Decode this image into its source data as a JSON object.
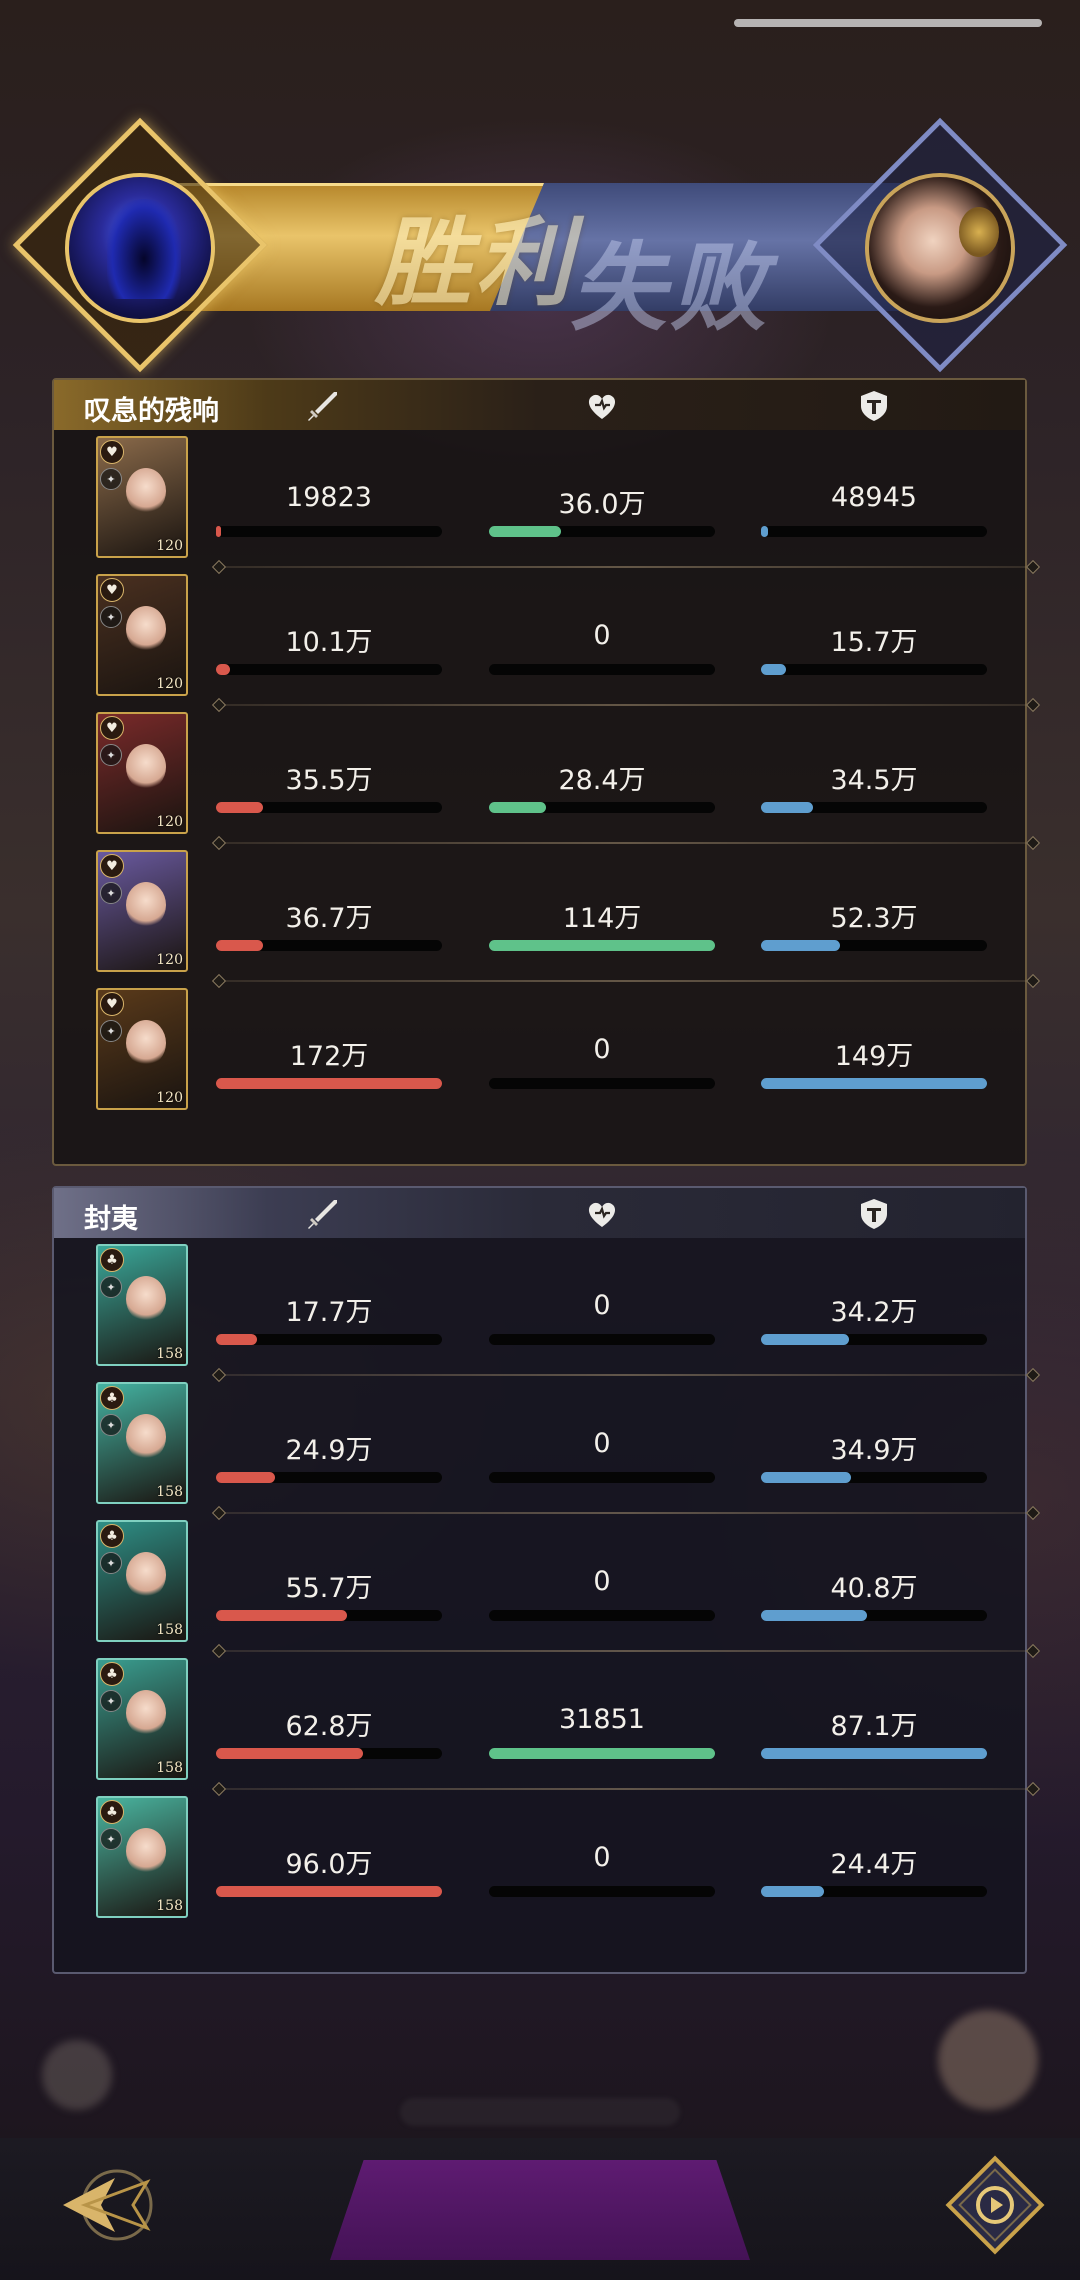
{
  "banner": {
    "win_label": "胜利",
    "lose_label": "失败"
  },
  "colors": {
    "attack": "#d9584c",
    "heal": "#5fc28a",
    "defense": "#5f9ecf",
    "gold": "#e9c46a"
  },
  "teams": [
    {
      "name": "叹息的残响",
      "rows": [
        {
          "level": "120",
          "attack": "19823",
          "heal": "36.0万",
          "defense": "48945",
          "attack_pct": 0.01,
          "heal_pct": 0.32,
          "defense_pct": 0.03
        },
        {
          "level": "120",
          "attack": "10.1万",
          "heal": "0",
          "defense": "15.7万",
          "attack_pct": 0.06,
          "heal_pct": 0,
          "defense_pct": 0.11
        },
        {
          "level": "120",
          "attack": "35.5万",
          "heal": "28.4万",
          "defense": "34.5万",
          "attack_pct": 0.21,
          "heal_pct": 0.25,
          "defense_pct": 0.23
        },
        {
          "level": "120",
          "attack": "36.7万",
          "heal": "114万",
          "defense": "52.3万",
          "attack_pct": 0.21,
          "heal_pct": 1.0,
          "defense_pct": 0.35
        },
        {
          "level": "120",
          "attack": "172万",
          "heal": "0",
          "defense": "149万",
          "attack_pct": 1.0,
          "heal_pct": 0,
          "defense_pct": 1.0
        }
      ]
    },
    {
      "name": "封夷",
      "rows": [
        {
          "level": "158",
          "attack": "17.7万",
          "heal": "0",
          "defense": "34.2万",
          "attack_pct": 0.18,
          "heal_pct": 0,
          "defense_pct": 0.39
        },
        {
          "level": "158",
          "attack": "24.9万",
          "heal": "0",
          "defense": "34.9万",
          "attack_pct": 0.26,
          "heal_pct": 0,
          "defense_pct": 0.4
        },
        {
          "level": "158",
          "attack": "55.7万",
          "heal": "0",
          "defense": "40.8万",
          "attack_pct": 0.58,
          "heal_pct": 0,
          "defense_pct": 0.47
        },
        {
          "level": "158",
          "attack": "62.8万",
          "heal": "31851",
          "defense": "87.1万",
          "attack_pct": 0.65,
          "heal_pct": 1.0,
          "defense_pct": 1.0
        },
        {
          "level": "158",
          "attack": "96.0万",
          "heal": "0",
          "defense": "24.4万",
          "attack_pct": 1.0,
          "heal_pct": 0,
          "defense_pct": 0.28
        }
      ]
    }
  ],
  "icons": {
    "attack": "sword-icon",
    "heal": "heart-icon",
    "defense": "shield-icon",
    "back": "back-arrow-icon",
    "replay": "replay-icon"
  }
}
